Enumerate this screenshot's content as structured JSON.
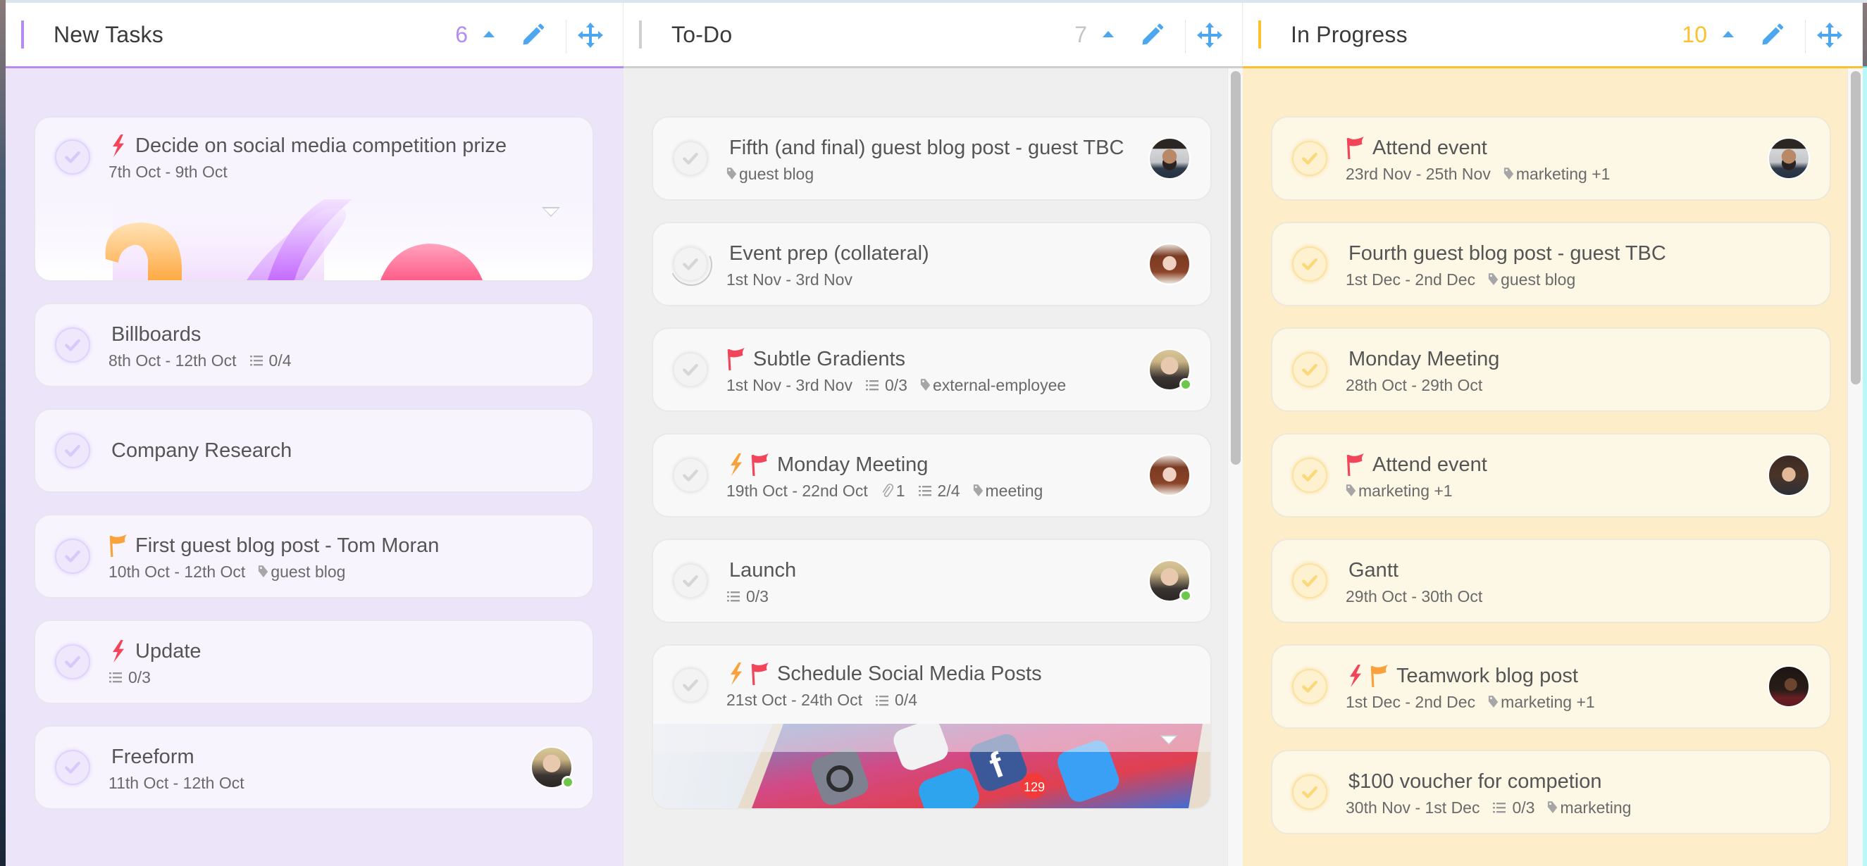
{
  "colors": {
    "new_tasks_accent": "#b48cf2",
    "todo_accent": "#cfcfcf",
    "in_progress_accent": "#fbc02d",
    "icon_blue": "#4da6f0",
    "priority_red": "#f2455a",
    "priority_orange": "#f9a23b",
    "online_green": "#6cc74a"
  },
  "columns": [
    {
      "title": "New Tasks",
      "count": "6",
      "count_color": "#b48cf2",
      "cards": [
        {
          "title": "Decide on social media competition prize",
          "icons": [
            "bolt-red"
          ],
          "dates": "7th Oct - 9th Oct",
          "cover": "abstract-shapes"
        },
        {
          "title": "Billboards",
          "icons": [],
          "dates": "8th Oct - 12th Oct",
          "checklist": "0/4"
        },
        {
          "title": "Company Research",
          "icons": []
        },
        {
          "title": "First guest blog post - Tom Moran",
          "icons": [
            "flag-orange"
          ],
          "dates": "10th Oct - 12th Oct",
          "tag": "guest blog"
        },
        {
          "title": "Update",
          "icons": [
            "bolt-red"
          ],
          "checklist": "0/3"
        },
        {
          "title": "Freeform",
          "icons": [],
          "dates": "11th Oct - 12th Oct",
          "avatar": "woman-glasses",
          "online": true
        }
      ]
    },
    {
      "title": "To-Do",
      "count": "7",
      "count_color": "#c4c4c4",
      "cards": [
        {
          "title": "Fifth (and final) guest blog post - guest TBC",
          "icons": [],
          "tag": "guest blog",
          "avatar": "man-beard"
        },
        {
          "title": "Event prep (collateral)",
          "icons": [],
          "dates": "1st Nov - 3rd Nov",
          "avatar": "woman-red-hair",
          "in_progress": true
        },
        {
          "title": "Subtle Gradients",
          "icons": [
            "flag-red"
          ],
          "dates": "1st Nov - 3rd Nov",
          "checklist": "0/3",
          "tag": "external-employee",
          "avatar": "woman-glasses",
          "online": true
        },
        {
          "title": "Monday Meeting",
          "icons": [
            "bolt-orange",
            "flag-red"
          ],
          "dates": "19th Oct - 22nd Oct",
          "attachments": "1",
          "checklist": "2/4",
          "tag": "meeting",
          "avatar": "woman-red-hair"
        },
        {
          "title": "Launch",
          "icons": [],
          "checklist": "0/3",
          "avatar": "woman-glasses",
          "online": true
        },
        {
          "title": "Schedule Social Media Posts",
          "icons": [
            "bolt-orange",
            "flag-red"
          ],
          "dates": "21st Oct - 24th Oct",
          "checklist": "0/4",
          "cover": "phone-apps"
        }
      ]
    },
    {
      "title": "In Progress",
      "count": "10",
      "count_color": "#fbc02d",
      "cards": [
        {
          "title": "Attend event",
          "icons": [
            "flag-red"
          ],
          "dates": "23rd Nov - 25th Nov",
          "tag": "marketing +1",
          "avatar": "man-beard"
        },
        {
          "title": "Fourth guest blog post - guest TBC",
          "icons": [],
          "dates": "1st Dec - 2nd Dec",
          "tag": "guest blog"
        },
        {
          "title": "Monday Meeting",
          "icons": [],
          "dates": "28th Oct - 29th Oct"
        },
        {
          "title": "Attend event",
          "icons": [
            "flag-red"
          ],
          "tag": "marketing +1",
          "avatar": "woman-curly-smile"
        },
        {
          "title": "Gantt",
          "icons": [],
          "dates": "29th Oct - 30th Oct"
        },
        {
          "title": "Teamwork blog post",
          "icons": [
            "bolt-red",
            "flag-orange"
          ],
          "dates": "1st Dec - 2nd Dec",
          "tag": "marketing +1",
          "avatar": "woman-dark-curly"
        },
        {
          "title": "$100 voucher for competion",
          "icons": [],
          "dates": "30th Nov - 1st Dec",
          "checklist": "0/3",
          "tag": "marketing"
        }
      ]
    }
  ],
  "column_scroll": [
    {
      "column": "To-Do",
      "position": 0.0,
      "visible_fraction": 0.5
    },
    {
      "column": "In Progress",
      "position": 0.0,
      "visible_fraction": 0.4
    }
  ]
}
